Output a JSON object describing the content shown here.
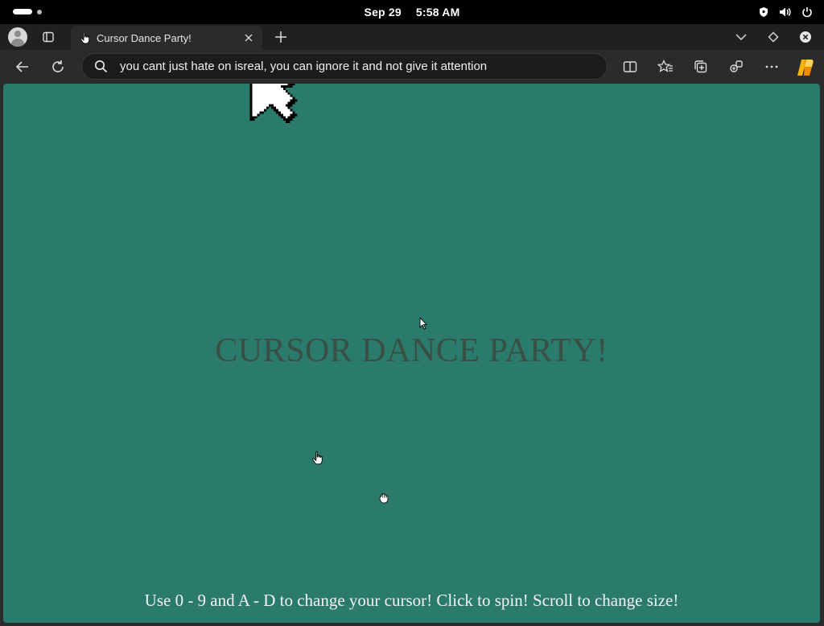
{
  "system_bar": {
    "date": "Sep 29",
    "time": "5:58 AM",
    "icons": [
      "activities-pill-icon",
      "workspace-dot-icon",
      "shield-icon",
      "volume-icon",
      "power-icon"
    ]
  },
  "browser": {
    "tab": {
      "title": "Cursor Dance Party!",
      "favicon": "hand-cursor-icon"
    },
    "address_bar": {
      "value": "you cant just hate on isreal, you can ignore it and not give it attention"
    },
    "toolbar_icons": [
      "back-icon",
      "refresh-icon",
      "split-screen-icon",
      "favorites-icon",
      "collections-icon",
      "browser-essentials-icon",
      "more-icon",
      "copilot-icon"
    ],
    "tabstrip_icons": [
      "profile-icon",
      "workspaces-icon",
      "new-tab-icon",
      "tab-list-icon",
      "diamond-icon",
      "window-close-icon"
    ]
  },
  "page": {
    "background": "#2b7b6d",
    "headline": "CURSOR DANCE PARTY!",
    "instructions": "Use 0 - 9 and A - D to change your cursor! Click to spin! Scroll to change size!",
    "cursors": [
      "large-arrow-cursor",
      "small-arrow-cursor",
      "hand-cursor",
      "grab-hand-cursor"
    ]
  }
}
